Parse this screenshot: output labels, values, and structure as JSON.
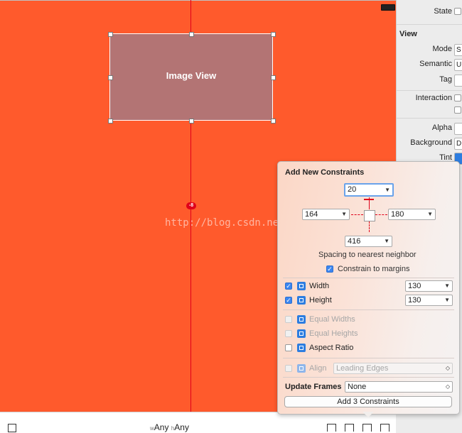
{
  "canvas": {
    "image_view_label": "Image View",
    "constraint_badge": "-8",
    "watermark": "http://blog.csdn.net"
  },
  "inspector": {
    "state_label": "State",
    "view_section": "View",
    "mode_label": "Mode",
    "mode_value": "S",
    "semantic_label": "Semantic",
    "semantic_value": "U",
    "tag_label": "Tag",
    "interaction_label": "Interaction",
    "alpha_label": "Alpha",
    "background_label": "Background",
    "background_value": "D",
    "tint_label": "Tint"
  },
  "bottom_bar": {
    "w_prefix": "w",
    "w_value": "Any",
    "h_prefix": "h",
    "h_value": "Any"
  },
  "popover": {
    "title": "Add New Constraints",
    "top_value": "20",
    "leading_value": "164",
    "trailing_value": "180",
    "bottom_value": "416",
    "spacing_label": "Spacing to nearest neighbor",
    "constrain_margins_label": "Constrain to margins",
    "width_label": "Width",
    "width_value": "130",
    "height_label": "Height",
    "height_value": "130",
    "equal_widths_label": "Equal Widths",
    "equal_heights_label": "Equal Heights",
    "aspect_ratio_label": "Aspect Ratio",
    "align_label": "Align",
    "align_value": "Leading Edges",
    "update_frames_label": "Update Frames",
    "update_frames_value": "None",
    "add_button_label": "Add 3 Constraints"
  },
  "colors": {
    "canvas": "#ff5a2c",
    "guide_line": "#e0001a",
    "checkbox_accent": "#3b86f0"
  }
}
